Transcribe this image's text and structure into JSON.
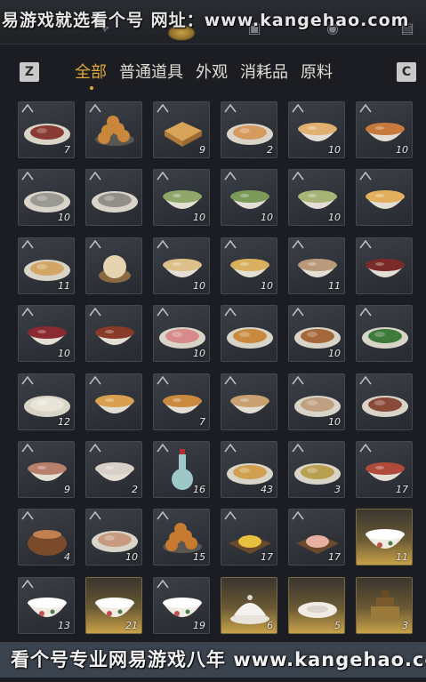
{
  "watermark_top": "易游戏就选看个号  网址：www.kangehao.com",
  "key_left": "Z",
  "key_right": "C",
  "tabs": [
    "全部",
    "普通道具",
    "外观",
    "消耗品",
    "原料"
  ],
  "active_tab": 0,
  "items": [
    {
      "icon": "sliced-meat-plate-icon",
      "count": "7",
      "style": "plate",
      "food": "#8a3a35"
    },
    {
      "icon": "fried-dumplings-icon",
      "count": "",
      "style": "pile",
      "food": "#c8873a"
    },
    {
      "icon": "cake-icon",
      "count": "9",
      "style": "cake",
      "food": "#d9a45a"
    },
    {
      "icon": "fish-plate-icon",
      "count": "2",
      "style": "plate",
      "food": "#d49a5e"
    },
    {
      "icon": "egg-soup-bowl-icon",
      "count": "10",
      "style": "bowl",
      "food": "#e0b070"
    },
    {
      "icon": "stew-bowl-icon",
      "count": "10",
      "style": "bowl",
      "food": "#c77a3c"
    },
    {
      "icon": "oyster-plate-icon",
      "count": "10",
      "style": "plate",
      "food": "#9a9a92"
    },
    {
      "icon": "oyster-plate-icon",
      "count": "",
      "style": "plate",
      "food": "#8f8f88"
    },
    {
      "icon": "vegetable-soup-icon",
      "count": "10",
      "style": "bowl",
      "food": "#8fa86a"
    },
    {
      "icon": "greens-soup-icon",
      "count": "10",
      "style": "bowl",
      "food": "#7c9a58"
    },
    {
      "icon": "pea-soup-icon",
      "count": "10",
      "style": "bowl",
      "food": "#a8b476"
    },
    {
      "icon": "tofu-soup-icon",
      "count": "",
      "style": "bowl",
      "food": "#e2b05c"
    },
    {
      "icon": "flatbread-icon",
      "count": "11",
      "style": "plate",
      "food": "#d3a665"
    },
    {
      "icon": "steamed-bun-icon",
      "count": "",
      "style": "bun",
      "food": "#e6d4b0"
    },
    {
      "icon": "noodle-bowl-icon",
      "count": "10",
      "style": "bowl",
      "food": "#dcc08a"
    },
    {
      "icon": "noodle-soup-icon",
      "count": "10",
      "style": "bowl",
      "food": "#d8b060"
    },
    {
      "icon": "porridge-bowl-icon",
      "count": "11",
      "style": "bowl",
      "food": "#b89a7a"
    },
    {
      "icon": "red-soup-bowl-icon",
      "count": "",
      "style": "bowl",
      "food": "#7a2a28"
    },
    {
      "icon": "red-bean-bowl-icon",
      "count": "10",
      "style": "bowl",
      "food": "#8a2a30"
    },
    {
      "icon": "broth-bowl-icon",
      "count": "",
      "style": "bowl",
      "food": "#8a3a28"
    },
    {
      "icon": "fish-slices-icon",
      "count": "10",
      "style": "plate",
      "food": "#d88a8a"
    },
    {
      "icon": "fried-fish-icon",
      "count": "",
      "style": "plate",
      "food": "#c98a40"
    },
    {
      "icon": "braised-meat-icon",
      "count": "10",
      "style": "plate",
      "food": "#a4683a"
    },
    {
      "icon": "greens-plate-icon",
      "count": "",
      "style": "plate",
      "food": "#3e7a3a"
    },
    {
      "icon": "rice-balls-icon",
      "count": "12",
      "style": "plate",
      "food": "#e8e4d8"
    },
    {
      "icon": "noodle-bowl-icon",
      "count": "",
      "style": "bowl",
      "food": "#d8a050"
    },
    {
      "icon": "dumpling-soup-icon",
      "count": "7",
      "style": "bowl",
      "food": "#c98a40"
    },
    {
      "icon": "clear-soup-icon",
      "count": "",
      "style": "bowl",
      "food": "#c9a070"
    },
    {
      "icon": "mushroom-plate-icon",
      "count": "10",
      "style": "plate",
      "food": "#c0a080"
    },
    {
      "icon": "shredded-meat-icon",
      "count": "",
      "style": "plate",
      "food": "#8a4a3a"
    },
    {
      "icon": "congee-bowl-icon",
      "count": "9",
      "style": "bowl",
      "food": "#b8806a"
    },
    {
      "icon": "flour-bowl-icon",
      "count": "2",
      "style": "bowl",
      "food": "#d8d0c8"
    },
    {
      "icon": "wine-vase-icon",
      "count": "16",
      "style": "vase",
      "food": "#9ec8c8"
    },
    {
      "icon": "fried-noodles-icon",
      "count": "43",
      "style": "plate",
      "food": "#d0a050"
    },
    {
      "icon": "fried-rice-icon",
      "count": "3",
      "style": "plate",
      "food": "#b8a050"
    },
    {
      "icon": "spicy-meat-icon",
      "count": "17",
      "style": "bowl",
      "food": "#b04a3a"
    },
    {
      "icon": "clay-pot-icon",
      "count": "4",
      "style": "pot",
      "food": "#7a4a2a"
    },
    {
      "icon": "sliced-pork-icon",
      "count": "10",
      "style": "plate",
      "food": "#c89a80"
    },
    {
      "icon": "meatballs-icon",
      "count": "15",
      "style": "pile",
      "food": "#c87a30"
    },
    {
      "icon": "egg-dish-icon",
      "count": "17",
      "style": "tray",
      "food": "#e8c040"
    },
    {
      "icon": "peach-bun-icon",
      "count": "17",
      "style": "tray",
      "food": "#e8b0a0"
    },
    {
      "icon": "porcelain-bowl-icon",
      "count": "11",
      "style": "porcelain",
      "food": "#f0ece4",
      "gold": true
    },
    {
      "icon": "porcelain-bowl-icon",
      "count": "13",
      "style": "porcelain",
      "food": "#f0ece4"
    },
    {
      "icon": "porcelain-bowl-icon",
      "count": "21",
      "style": "porcelain",
      "food": "#f0ece4",
      "gold": true
    },
    {
      "icon": "rooster-bowl-icon",
      "count": "19",
      "style": "porcelain",
      "food": "#f0ece4"
    },
    {
      "icon": "covered-bowl-icon",
      "count": "6",
      "style": "covered",
      "food": "#f4f2ee",
      "gold": true
    },
    {
      "icon": "porcelain-dish-icon",
      "count": "5",
      "style": "dish",
      "food": "#f0ece4",
      "gold": true
    },
    {
      "icon": "bronze-seal-icon",
      "count": "3",
      "style": "seal",
      "food": "#9a7a3a",
      "gold": true
    }
  ],
  "watermark_bottom": "看个号专业网易游戏八年  www.kangehao.com 看个号"
}
